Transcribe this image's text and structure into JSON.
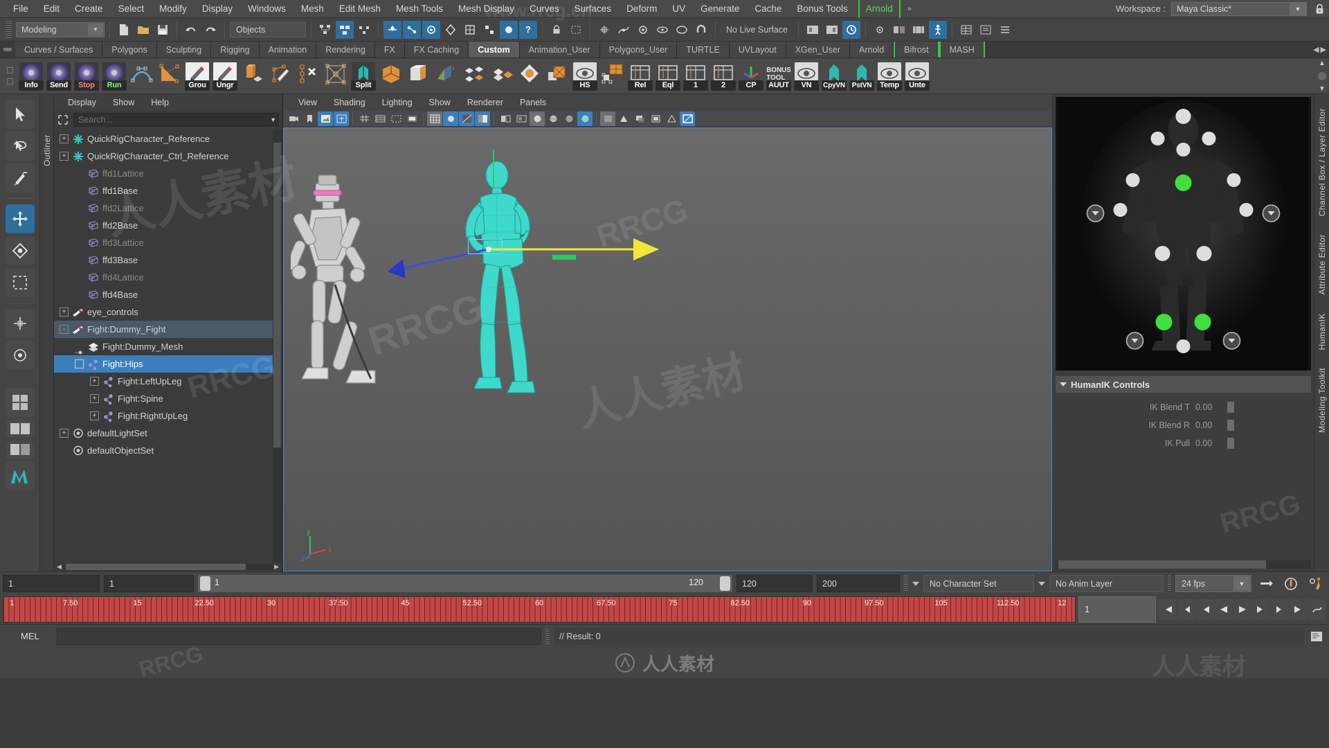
{
  "menubar": {
    "items": [
      "File",
      "Edit",
      "Create",
      "Select",
      "Modify",
      "Display",
      "Windows",
      "Mesh",
      "Edit Mesh",
      "Mesh Tools",
      "Mesh Display",
      "Curves",
      "Surfaces",
      "Deform",
      "UV",
      "Generate",
      "Cache",
      "Bonus Tools"
    ],
    "highlighted": "Arnold",
    "overflow": "»",
    "workspace_label": "Workspace :",
    "workspace_value": "Maya Classic*",
    "lock_icon": "lock-icon"
  },
  "statusbar": {
    "mode": "Modeling",
    "objects_field": "Objects",
    "live_surface": "No Live Surface"
  },
  "shelf_tabs": {
    "items": [
      {
        "label": "Curves / Surfaces",
        "active": false,
        "green": false
      },
      {
        "label": "Polygons",
        "active": false,
        "green": false
      },
      {
        "label": "Sculpting",
        "active": false,
        "green": false
      },
      {
        "label": "Rigging",
        "active": false,
        "green": false
      },
      {
        "label": "Animation",
        "active": false,
        "green": false
      },
      {
        "label": "Rendering",
        "active": false,
        "green": false
      },
      {
        "label": "FX",
        "active": false,
        "green": false
      },
      {
        "label": "FX Caching",
        "active": false,
        "green": false
      },
      {
        "label": "Custom",
        "active": true,
        "green": false
      },
      {
        "label": "Animation_User",
        "active": false,
        "green": false
      },
      {
        "label": "Polygons_User",
        "active": false,
        "green": false
      },
      {
        "label": "TURTLE",
        "active": false,
        "green": false
      },
      {
        "label": "UVLayout",
        "active": false,
        "green": false
      },
      {
        "label": "XGen_User",
        "active": false,
        "green": false
      },
      {
        "label": "Arnold",
        "active": false,
        "green": false
      },
      {
        "label": "Bifrost",
        "active": false,
        "green": true
      },
      {
        "label": "MASH",
        "active": false,
        "green": true
      }
    ]
  },
  "shelf_buttons": [
    {
      "name": "info-button",
      "caption": "Info",
      "cap_color": "#ffffff",
      "style": "disc"
    },
    {
      "name": "send-button",
      "caption": "Send",
      "cap_color": "#ffffff",
      "style": "disc"
    },
    {
      "name": "stop-button",
      "caption": "Stop",
      "cap_color": "#ff8080",
      "style": "disc"
    },
    {
      "name": "run-button",
      "caption": "Run",
      "cap_color": "#7dff7d",
      "style": "disc"
    },
    {
      "name": "curve-tool",
      "caption": "",
      "style": "curve"
    },
    {
      "name": "lattice-tool",
      "caption": "",
      "style": "lattice"
    },
    {
      "name": "group-button",
      "caption": "Grou",
      "style": "pencil"
    },
    {
      "name": "ungroup-button",
      "caption": "Ungr",
      "style": "pencil"
    },
    {
      "name": "extrude-tool",
      "caption": "",
      "style": "cube-orange"
    },
    {
      "name": "sculpt-tool",
      "caption": "",
      "style": "brush"
    },
    {
      "name": "multicut-tool",
      "caption": "",
      "style": "points-x"
    },
    {
      "name": "target-weld",
      "caption": "",
      "style": "quad"
    },
    {
      "name": "split-tool",
      "caption": "Split",
      "style": "teal"
    },
    {
      "name": "bevel-tool",
      "caption": "",
      "style": "cube-orange2"
    },
    {
      "name": "boolean-tool",
      "caption": "",
      "style": "cube-white"
    },
    {
      "name": "mirror-tool",
      "caption": "",
      "style": "mirror"
    },
    {
      "name": "plane-stack-tool",
      "caption": "",
      "style": "planes"
    },
    {
      "name": "plane-stack2-tool",
      "caption": "",
      "style": "planes2"
    },
    {
      "name": "sphere-tool",
      "caption": "",
      "style": "diamond"
    },
    {
      "name": "uv-tool",
      "caption": "",
      "style": "uvcross"
    },
    {
      "name": "hypershade-button",
      "caption": "HS",
      "style": "eye"
    },
    {
      "name": "uv-layout-tool",
      "caption": "",
      "style": "orangeuv"
    },
    {
      "name": "relative-button",
      "caption": "Rel",
      "style": "grid"
    },
    {
      "name": "equal-button",
      "caption": "Eql",
      "style": "grid"
    },
    {
      "name": "one-button",
      "caption": "1",
      "style": "grid"
    },
    {
      "name": "two-button",
      "caption": "2",
      "style": "grid"
    },
    {
      "name": "copy-pivot-button",
      "caption": "CP",
      "style": "axis"
    },
    {
      "name": "bonus-tool-button",
      "caption": "AUUT",
      "caption_top": "BONUS TOOL",
      "style": "text"
    },
    {
      "name": "vn-button",
      "caption": "VN",
      "style": "eye"
    },
    {
      "name": "copy-vn-button",
      "caption": "CpyVN",
      "style": "teal"
    },
    {
      "name": "paste-vn-button",
      "caption": "PstVN",
      "style": "teal"
    },
    {
      "name": "temp-button",
      "caption": "Temp",
      "style": "eye"
    },
    {
      "name": "unte-button",
      "caption": "Unte",
      "style": "eye"
    }
  ],
  "toolbox": {
    "side_label": "Outliner",
    "tools": [
      "select-tool",
      "lasso-tool",
      "paint-select-tool",
      "move-tool",
      "rotate-tool",
      "scale-tool",
      "last-tool",
      "show-manip-tool"
    ]
  },
  "outliner": {
    "menus": [
      "Display",
      "Show",
      "Help"
    ],
    "search_placeholder": "Search...",
    "rows": [
      {
        "label": "QuickRigCharacter_Reference",
        "indent": 0,
        "expander": "+",
        "icon": "reference-icon",
        "dim": false,
        "state": "none"
      },
      {
        "label": "QuickRigCharacter_Ctrl_Reference",
        "indent": 0,
        "expander": "+",
        "icon": "reference-icon",
        "dim": false,
        "state": "none"
      },
      {
        "label": "ffd1Lattice",
        "indent": 1,
        "expander": "",
        "icon": "lattice-icon",
        "dim": true,
        "state": "none"
      },
      {
        "label": "ffd1Base",
        "indent": 1,
        "expander": "",
        "icon": "lattice-icon",
        "dim": false,
        "state": "none"
      },
      {
        "label": "ffd2Lattice",
        "indent": 1,
        "expander": "",
        "icon": "lattice-icon",
        "dim": true,
        "state": "none"
      },
      {
        "label": "ffd2Base",
        "indent": 1,
        "expander": "",
        "icon": "lattice-icon",
        "dim": false,
        "state": "none"
      },
      {
        "label": "ffd3Lattice",
        "indent": 1,
        "expander": "",
        "icon": "lattice-icon",
        "dim": true,
        "state": "none"
      },
      {
        "label": "ffd3Base",
        "indent": 1,
        "expander": "",
        "icon": "lattice-icon",
        "dim": false,
        "state": "none"
      },
      {
        "label": "ffd4Lattice",
        "indent": 1,
        "expander": "",
        "icon": "lattice-icon",
        "dim": true,
        "state": "none"
      },
      {
        "label": "ffd4Base",
        "indent": 1,
        "expander": "",
        "icon": "lattice-icon",
        "dim": false,
        "state": "none"
      },
      {
        "label": "eye_controls",
        "indent": 0,
        "expander": "+",
        "icon": "transform-icon",
        "dim": false,
        "state": "none"
      },
      {
        "label": "Fight:Dummy_Fight",
        "indent": 0,
        "expander": "-",
        "icon": "transform-icon",
        "dim": false,
        "state": "highlight"
      },
      {
        "label": "Fight:Dummy_Mesh",
        "indent": 1,
        "expander": "dot",
        "icon": "mesh-icon",
        "dim": false,
        "state": "none"
      },
      {
        "label": "Fight:Hips",
        "indent": 1,
        "expander": "box",
        "icon": "joint-icon",
        "dim": false,
        "state": "selected"
      },
      {
        "label": "Fight:LeftUpLeg",
        "indent": 2,
        "expander": "+",
        "icon": "joint-icon",
        "dim": false,
        "state": "none"
      },
      {
        "label": "Fight:Spine",
        "indent": 2,
        "expander": "+",
        "icon": "joint-icon",
        "dim": false,
        "state": "none"
      },
      {
        "label": "Fight:RightUpLeg",
        "indent": 2,
        "expander": "+",
        "icon": "joint-icon",
        "dim": false,
        "state": "none"
      },
      {
        "label": "defaultLightSet",
        "indent": 0,
        "expander": "+",
        "icon": "set-icon",
        "dim": false,
        "state": "none"
      },
      {
        "label": "defaultObjectSet",
        "indent": 0,
        "expander": "",
        "icon": "set-icon",
        "dim": false,
        "state": "none"
      }
    ]
  },
  "viewport": {
    "menus": [
      "View",
      "Shading",
      "Lighting",
      "Show",
      "Renderer",
      "Panels"
    ],
    "axis_labels": {
      "x": "x",
      "y": "y",
      "z": "z"
    }
  },
  "right_dock": {
    "hik_title": "HumanIK Controls",
    "controls": [
      {
        "label": "IK Blend T",
        "value": "0.00"
      },
      {
        "label": "IK Blend R",
        "value": "0.00"
      },
      {
        "label": "IK Pull",
        "value": "0.00"
      }
    ],
    "side_labels": [
      "Channel Box / Layer Editor",
      "Attribute Editor",
      "HumanIK",
      "Modeling Toolkit"
    ]
  },
  "time_controls": {
    "start_field": "1",
    "start_field2": "1",
    "range_start": "1",
    "range_end": "120",
    "anim_end": "120",
    "playback_end": "200",
    "character_set": "No Character Set",
    "anim_layer": "No Anim Layer",
    "fps": "24 fps"
  },
  "timeline": {
    "ticks": [
      "1",
      "7.50",
      "15",
      "22.50",
      "30",
      "37.50",
      "45",
      "52.50",
      "60",
      "67.50",
      "75",
      "82.50",
      "90",
      "97.50",
      "105",
      "112.50",
      "12"
    ],
    "current_frame": "1"
  },
  "command_line": {
    "label": "MEL",
    "input_value": "",
    "result": "// Result: 0"
  },
  "watermarks": {
    "site1": "www.rrcg.cn",
    "site2": "RRCG",
    "cn1": "人人素材",
    "bottom": "人人素材"
  },
  "colors": {
    "accent_blue": "#3d7ebd",
    "accent_green": "#3ec43e",
    "mesh_teal": "#3fd9cc",
    "timeline_red": "#b03434",
    "orange": "#e08b34"
  }
}
